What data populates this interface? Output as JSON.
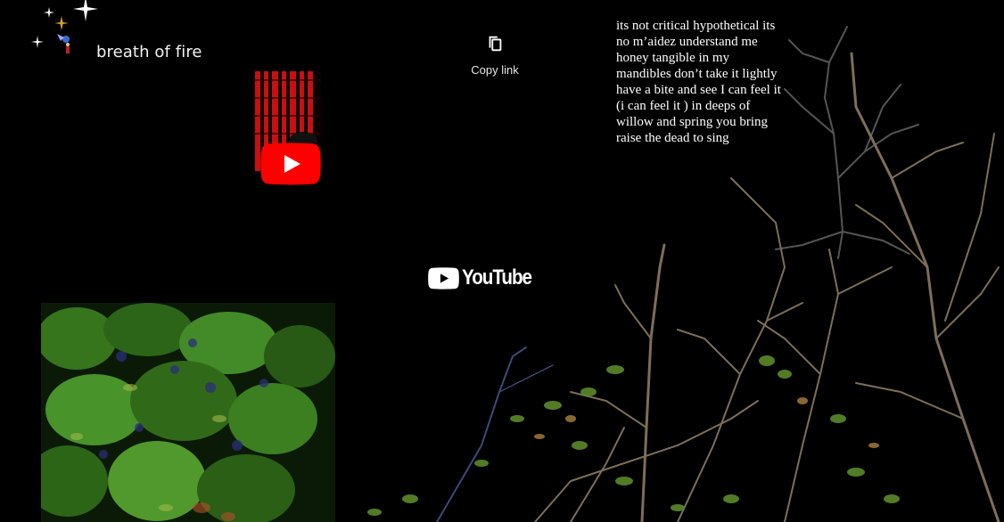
{
  "channel": {
    "title": "breath of fire",
    "avatar_icon": "sparkle-fairy-avatar-icon"
  },
  "video": {
    "play_icon": "youtube-play-icon",
    "play_color": "#ff0000"
  },
  "share": {
    "copy_link_label": "Copy link",
    "icon": "copy-icon"
  },
  "branding": {
    "wordmark": "YouTube",
    "icon": "youtube-logo-icon"
  },
  "poem": {
    "lines": [
      "its not critical hypothetical its",
      "no m’aidez understand me",
      "honey tangible in my",
      "mandibles don’t take it lightly",
      "have a bite and see I can feel it",
      "(i can feel it ) in deeps of",
      "willow and spring you bring",
      "raise the dead to sing"
    ]
  },
  "colors": {
    "background": "#000000",
    "thumbnail_red": "#d01010",
    "foliage_green": "#3f8a22",
    "branch_brown": "#8a7a60"
  }
}
